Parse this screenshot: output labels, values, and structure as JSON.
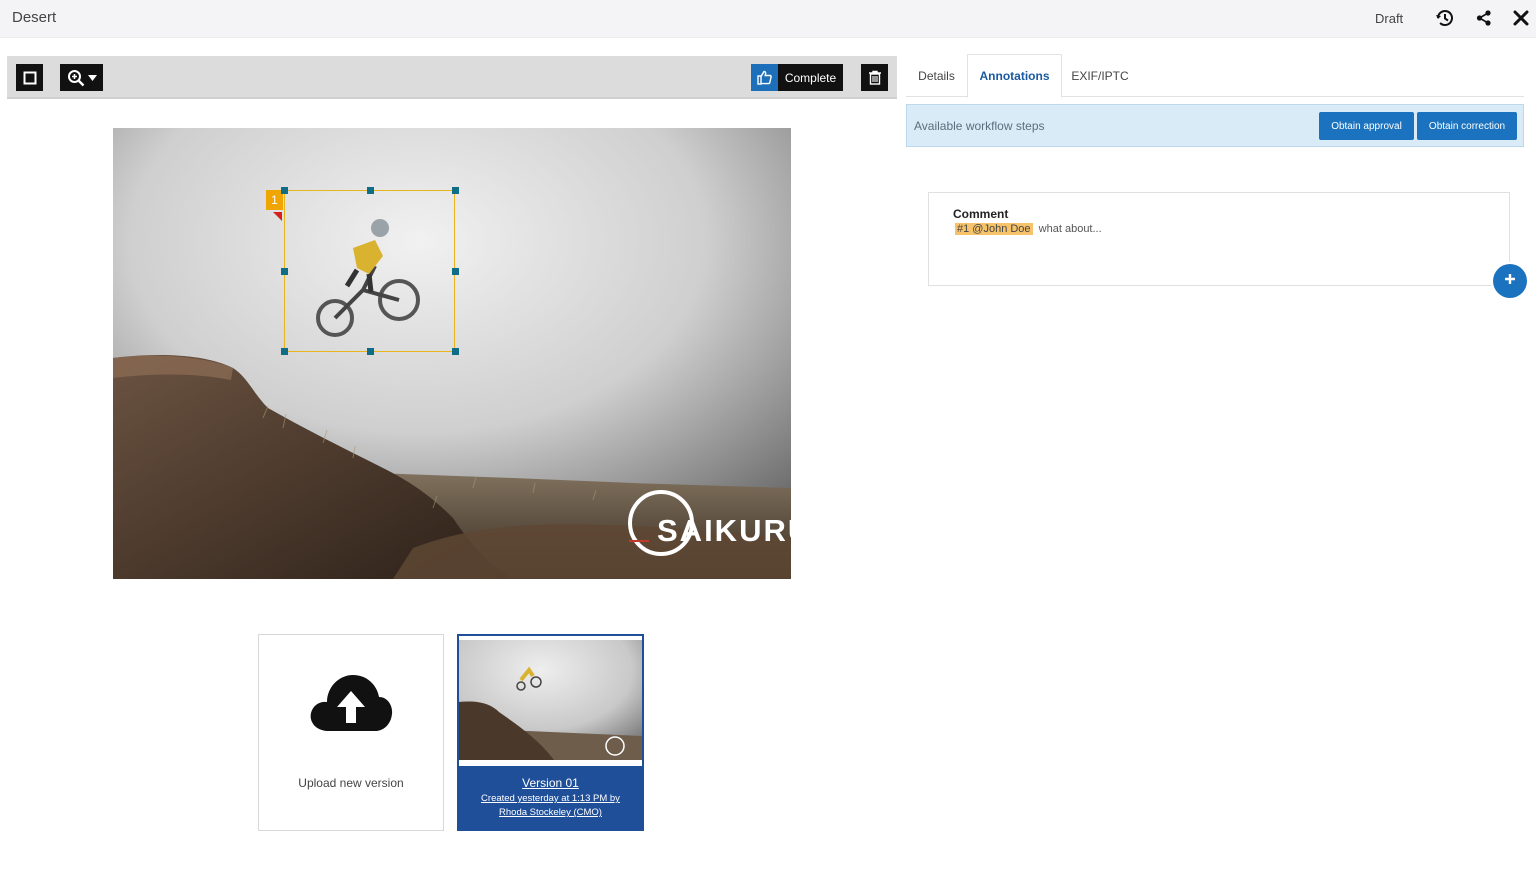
{
  "header": {
    "title": "Desert",
    "status": "Draft",
    "icons": [
      "history-icon",
      "share-icon",
      "close-icon"
    ]
  },
  "toolbar": {
    "select_tool_icon": "square-icon",
    "zoom_icon": "zoom-in-icon",
    "complete_label": "Complete",
    "complete_icon": "thumbs-up-icon",
    "delete_icon": "trash-icon"
  },
  "image": {
    "annotation_number": "1",
    "watermark": "SAIKURU"
  },
  "versions": {
    "upload_label": "Upload new version",
    "items": [
      {
        "title": "Version 01",
        "meta_line1": "Created yesterday at 1:13 PM by",
        "meta_line2": "Rhoda Stockeley (CMO)"
      }
    ]
  },
  "tabs": [
    {
      "label": "Details",
      "active": false
    },
    {
      "label": "Annotations",
      "active": true
    },
    {
      "label": "EXIF/IPTC",
      "active": false
    }
  ],
  "workflow": {
    "label": "Available workflow steps",
    "buttons": [
      "Obtain approval",
      "Obtain correction"
    ]
  },
  "comment": {
    "title": "Comment",
    "mention": "#1 @John Doe",
    "text": "what about..."
  },
  "colors": {
    "accent": "#1b73bf",
    "version_card": "#1f4f99",
    "annotation_box": "#e8b51a",
    "annotation_flag": "#f0a500",
    "workflow_bg": "#d9ebf7"
  }
}
